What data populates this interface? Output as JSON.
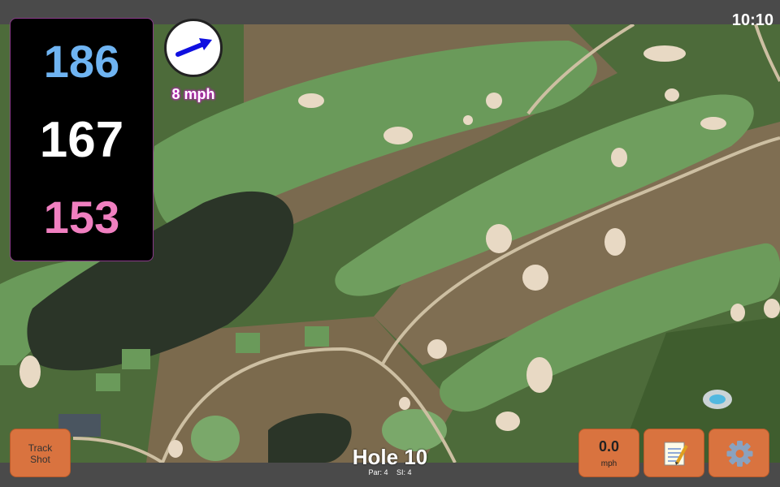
{
  "status": {
    "time": "10:10"
  },
  "distances": {
    "back": "186",
    "middle": "167",
    "front": "153"
  },
  "colors": {
    "back": "#6fb4f2",
    "middle": "#ffffff",
    "front": "#f07fc0",
    "button": "#d9733f",
    "wind_arrow": "#1010e0"
  },
  "wind": {
    "speed_label": "8 mph",
    "direction_icon": "arrow-icon"
  },
  "hole": {
    "title": "Hole 10",
    "par": "Par: 4",
    "si": "SI: 4"
  },
  "buttons": {
    "track_shot": "Track\nShot",
    "speed_value": "0.0",
    "speed_unit": "mph",
    "notes_icon": "notepad-icon",
    "settings_icon": "gear-icon"
  }
}
